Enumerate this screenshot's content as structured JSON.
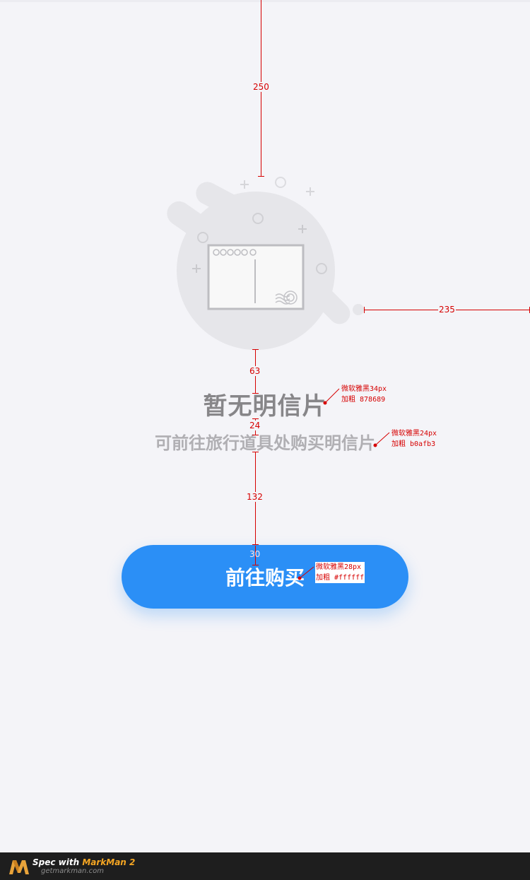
{
  "empty_state": {
    "title": "暂无明信片",
    "subtitle": "可前往旅行道具处购买明信片"
  },
  "buy_button": {
    "label": "前往购买"
  },
  "spec": {
    "dimensions": {
      "top_gap": "250",
      "right_gap": "235",
      "image_to_title": "63",
      "title_to_subtitle": "24",
      "subtitle_to_button": "132",
      "button_text_top": "30"
    },
    "notes": {
      "title_font": "微软雅黑34px",
      "title_color": "加粗 878689",
      "subtitle_font": "微软雅黑24px",
      "subtitle_color": "加粗 b0afb3",
      "button_font": "微软雅黑28px",
      "button_color": "加粗 #ffffff"
    }
  },
  "footer": {
    "spec_prefix": "Spec with ",
    "brand": "MarkMan 2",
    "url": "getmarkman.com"
  },
  "colors": {
    "background": "#f4f4f8",
    "title": "#878689",
    "subtitle": "#b0afb3",
    "button": "#2b8ff6",
    "button_text": "#ffffff",
    "spec": "#d60000"
  },
  "icons": {
    "illustration": "empty-postcard-illustration",
    "footer_logo": "markman-logo-icon"
  }
}
